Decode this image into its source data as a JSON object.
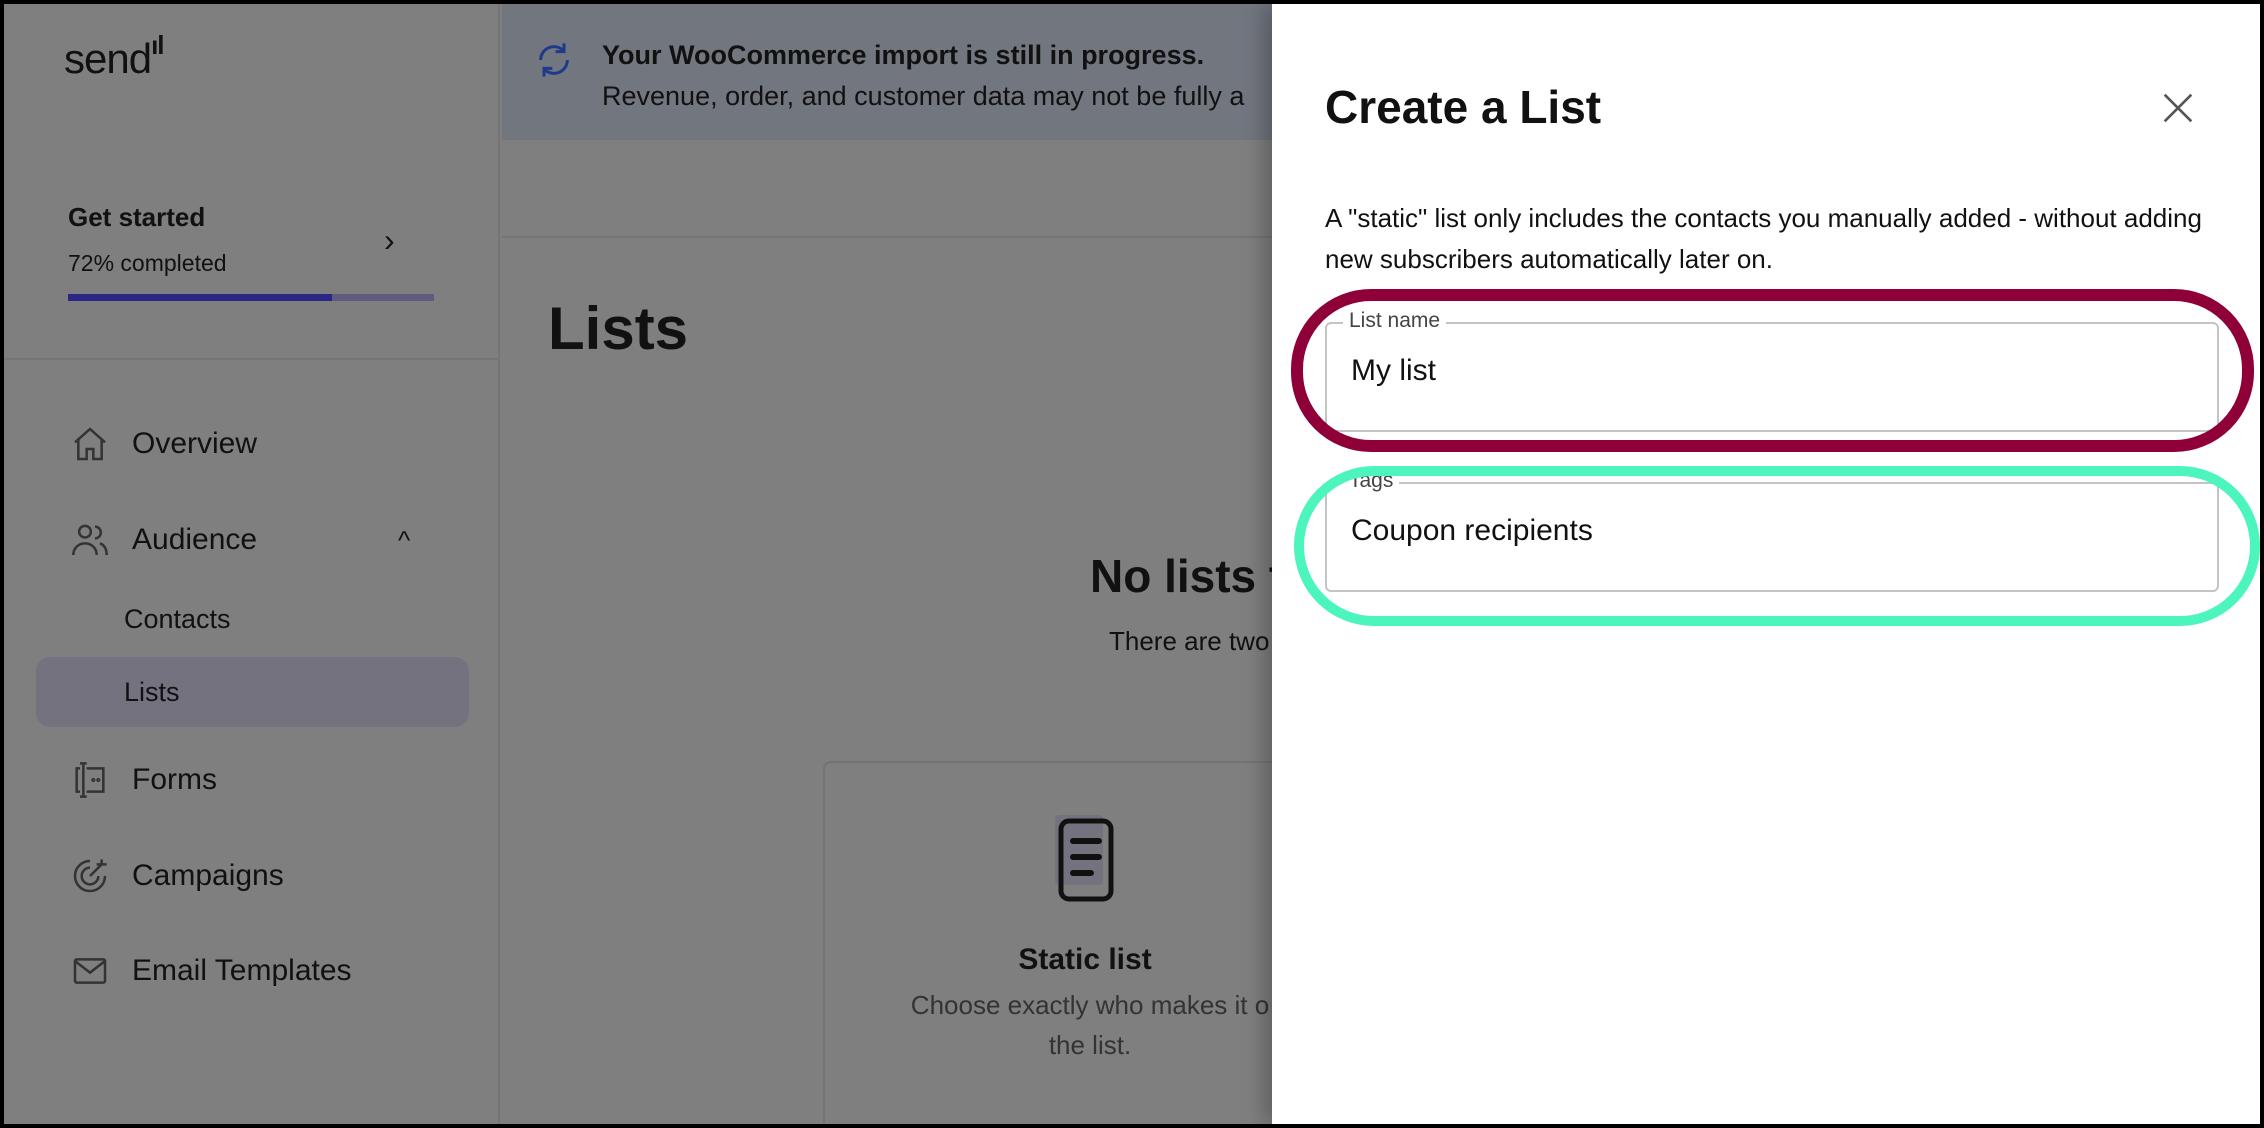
{
  "sidebar": {
    "logo": "send",
    "get_started": {
      "title": "Get started",
      "progress_text": "72% completed",
      "progress": 0.72
    },
    "items": [
      {
        "label": "Overview",
        "icon": "home-icon"
      },
      {
        "label": "Audience",
        "icon": "users-icon",
        "expanded": true,
        "children": [
          {
            "label": "Contacts"
          },
          {
            "label": "Lists",
            "active": true
          }
        ]
      },
      {
        "label": "Forms",
        "icon": "form-icon"
      },
      {
        "label": "Campaigns",
        "icon": "target-icon"
      },
      {
        "label": "Email Templates",
        "icon": "mail-icon"
      }
    ]
  },
  "banner": {
    "icon": "sync-icon",
    "title": "Your WooCommerce import is still in progress.",
    "text": "Revenue, order, and customer data may not be fully a"
  },
  "main": {
    "title": "Lists",
    "empty_title": "No lists t",
    "empty_text": "There are two",
    "card": {
      "icon": "document-list-icon",
      "title": "Static list",
      "desc_line1": "Choose exactly who makes it o",
      "desc_line2": "the list."
    }
  },
  "drawer": {
    "title": "Create a List",
    "close_icon": "close-icon",
    "description": "A \"static\" list only includes the contacts you manually added - without adding new subscribers automatically later on.",
    "fields": [
      {
        "label": "List name",
        "value": "My list"
      },
      {
        "label": "Tags",
        "value": "Coupon recipients"
      }
    ]
  },
  "annotations": {
    "list_name_color": "#900038",
    "tags_color": "#4cf5bd"
  }
}
